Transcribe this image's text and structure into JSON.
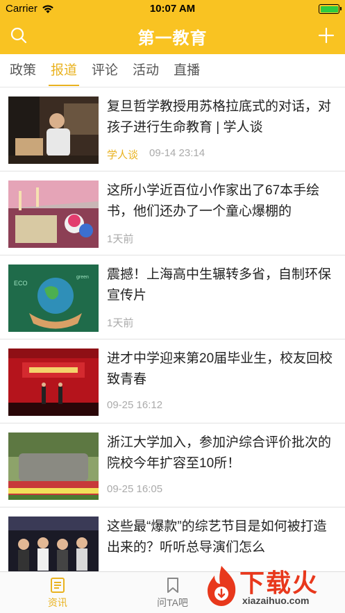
{
  "status_bar": {
    "carrier": "Carrier",
    "time": "10:07 AM",
    "battery_level": 1.0
  },
  "nav": {
    "title": "第一教育",
    "left_icon": "search-icon",
    "right_icon": "plus-icon"
  },
  "tabs": [
    {
      "label": "政策",
      "active": false
    },
    {
      "label": "报道",
      "active": true
    },
    {
      "label": "评论",
      "active": false
    },
    {
      "label": "活动",
      "active": false
    },
    {
      "label": "直播",
      "active": false
    }
  ],
  "news": [
    {
      "title": "复旦哲学教授用苏格拉底式的对话，对孩子进行生命教育 | 学人谈",
      "tag": "学人谈",
      "time": "09-14 23:14"
    },
    {
      "title": "这所小学近百位小作家出了67本手绘书，他们还办了一个童心爆棚的",
      "tag": "",
      "time": "1天前"
    },
    {
      "title": "震撼！上海高中生辗转多省，自制环保宣传片",
      "tag": "",
      "time": "1天前"
    },
    {
      "title": "进才中学迎来第20届毕业生，校友回校致青春",
      "tag": "",
      "time": "09-25 16:12"
    },
    {
      "title": "浙江大学加入，参加沪综合评价批次的院校今年扩容至10所！",
      "tag": "",
      "time": "09-25 16:05"
    },
    {
      "title": "这些最“爆款”的综艺节目是如何被打造出来的？听听总导演们怎么",
      "tag": "",
      "time": ""
    }
  ],
  "tab_bar": [
    {
      "label": "资讯",
      "icon": "news-icon",
      "active": true
    },
    {
      "label": "问TA吧",
      "icon": "bookmark-icon",
      "active": false
    }
  ],
  "watermark": {
    "text": "下载火",
    "url": "xiazaihuo.com"
  },
  "colors": {
    "brand_yellow": "#f9c322",
    "accent": "#e9b21f",
    "watermark_red": "#e8381c"
  }
}
